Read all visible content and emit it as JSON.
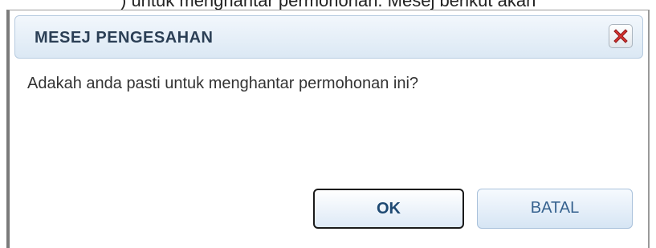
{
  "background": {
    "text": ") untuk menghantar permohonan. Mesej berikut akan"
  },
  "dialog": {
    "title": "MESEJ PENGESAHAN",
    "close_icon": "close-icon",
    "message": "Adakah anda pasti untuk menghantar permohonan ini?",
    "buttons": {
      "ok_label": "OK",
      "cancel_label": "BATAL"
    }
  },
  "colors": {
    "title_bar": "#dbe8f4",
    "close_icon": "#d8322f",
    "ok_text": "#1f4a73",
    "cancel_text": "#36628f"
  }
}
